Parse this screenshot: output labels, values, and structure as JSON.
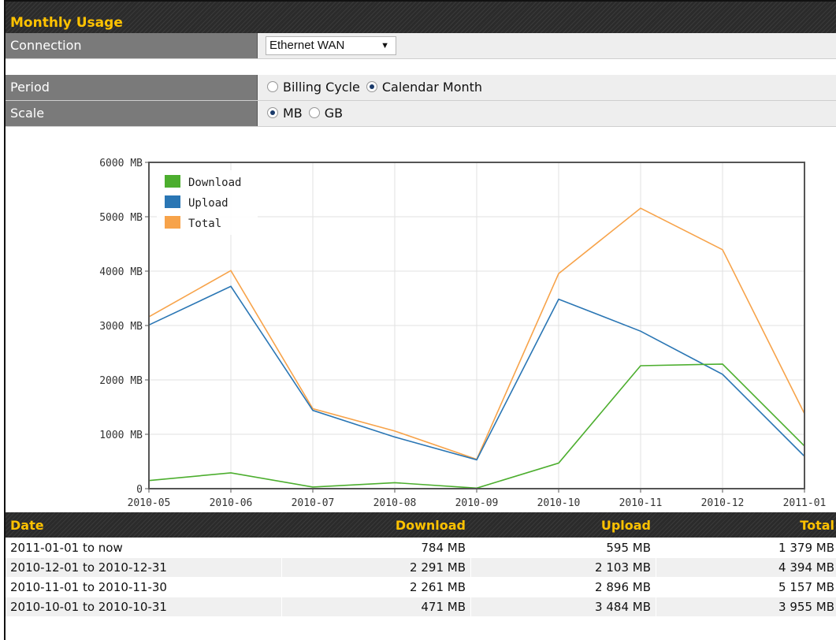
{
  "panel": {
    "title": "Monthly Usage"
  },
  "settings": {
    "connection": {
      "label": "Connection",
      "selected": "Ethernet WAN"
    },
    "period": {
      "label": "Period",
      "options": [
        "Billing Cycle",
        "Calendar Month"
      ],
      "selected": "Calendar Month"
    },
    "scale": {
      "label": "Scale",
      "options": [
        "MB",
        "GB"
      ],
      "selected": "MB"
    }
  },
  "chart_data": {
    "type": "line",
    "x": [
      "2010-05",
      "2010-06",
      "2010-07",
      "2010-08",
      "2010-09",
      "2010-10",
      "2010-11",
      "2010-12",
      "2011-01"
    ],
    "y_ticks": [
      "6000 MB",
      "5000 MB",
      "4000 MB",
      "3000 MB",
      "2000 MB",
      "1000 MB",
      "0"
    ],
    "ylim": [
      0,
      6000
    ],
    "legend_position": "top-left",
    "series": [
      {
        "name": "Download",
        "color": "#4cae2e",
        "values": [
          150,
          290,
          30,
          110,
          10,
          471,
          2261,
          2291,
          784
        ]
      },
      {
        "name": "Upload",
        "color": "#2a76b4",
        "values": [
          3010,
          3720,
          1440,
          950,
          530,
          3484,
          2896,
          2103,
          595
        ]
      },
      {
        "name": "Total",
        "color": "#f7a34a",
        "values": [
          3160,
          4010,
          1470,
          1060,
          540,
          3955,
          5157,
          4394,
          1379
        ]
      }
    ]
  },
  "table": {
    "headers": {
      "date": "Date",
      "download": "Download",
      "upload": "Upload",
      "total": "Total"
    },
    "rows": [
      {
        "date": "2011-01-01 to now",
        "download": "784 MB",
        "upload": "595 MB",
        "total": "1 379 MB"
      },
      {
        "date": "2010-12-01 to 2010-12-31",
        "download": "2 291 MB",
        "upload": "2 103 MB",
        "total": "4 394 MB"
      },
      {
        "date": "2010-11-01 to 2010-11-30",
        "download": "2 261 MB",
        "upload": "2 896 MB",
        "total": "5 157 MB"
      },
      {
        "date": "2010-10-01 to 2010-10-31",
        "download": "471 MB",
        "upload": "3 484 MB",
        "total": "3 955 MB"
      }
    ]
  }
}
